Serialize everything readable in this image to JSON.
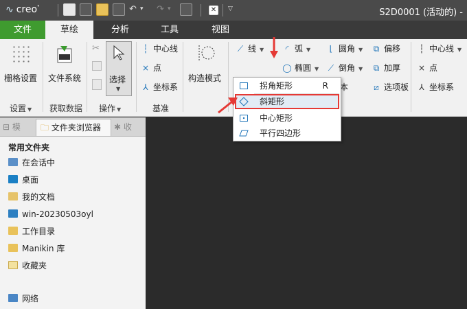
{
  "app": {
    "logo": "creo",
    "window_title": "S2D0001 (活动的) -"
  },
  "tabs": {
    "file": "文件",
    "sketch": "草绘",
    "analysis": "分析",
    "tools": "工具",
    "view": "视图"
  },
  "ribbon": {
    "grid_settings": "栅格设置",
    "file_system": "文件系统",
    "select": "选择",
    "centerline": "中心线",
    "point": "点",
    "coord_sys": "坐标系",
    "construction_mode": "构造模式",
    "line": "线",
    "arc": "弧",
    "fillet": "圆角",
    "offset": "偏移",
    "rectangle": "矩形",
    "ellipse": "椭圆",
    "chamfer": "倒角",
    "thicken": "加厚",
    "text": "文本",
    "palette": "选项板",
    "centerline_r": "中心线",
    "point_r": "点",
    "coord_sys_r": "坐标系",
    "groups": {
      "settings": "设置",
      "get_data": "获取数据",
      "operations": "操作",
      "datum": "基准"
    }
  },
  "rect_menu": {
    "items": [
      {
        "label": "拐角矩形",
        "shortcut": "R",
        "icon": "corner-rectangle-icon"
      },
      {
        "label": "斜矩形",
        "shortcut": "",
        "icon": "slanted-rectangle-icon"
      },
      {
        "label": "中心矩形",
        "shortcut": "",
        "icon": "center-rectangle-icon"
      },
      {
        "label": "平行四边形",
        "shortcut": "",
        "icon": "parallelogram-icon"
      }
    ],
    "highlighted_index": 1
  },
  "navigator": {
    "tabs": [
      "",
      "文件夹浏览器",
      ""
    ],
    "section_title": "常用文件夹",
    "items": [
      "在会话中",
      "桌面",
      "我的文档",
      "win-20230503oyl",
      "工作目录",
      "Manikin 库",
      "收藏夹",
      "网络"
    ]
  },
  "colors": {
    "accent_red": "#e53935",
    "file_tab_green": "#3f9b2f",
    "icon_blue": "#1d73b8"
  }
}
